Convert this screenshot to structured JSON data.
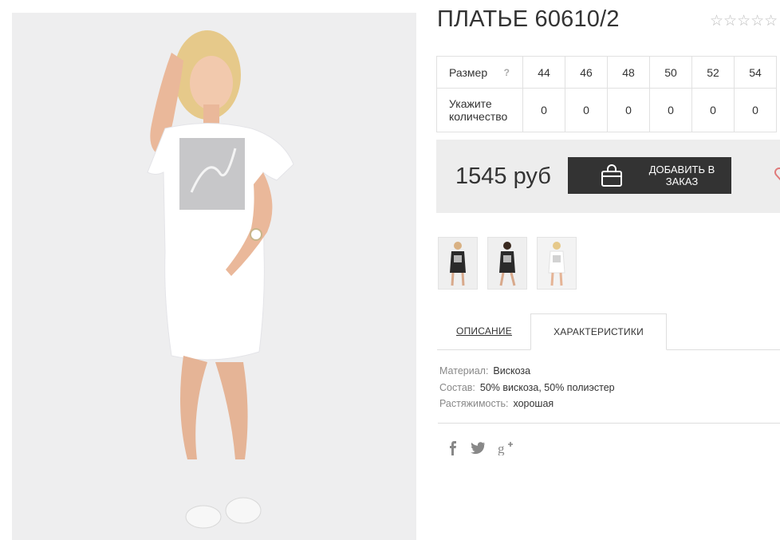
{
  "product": {
    "title": "ПЛАТЬЕ 60610/2",
    "rating_stars": "☆☆☆☆☆",
    "price": "1545 руб",
    "add_button": "ДОБАВИТЬ В ЗАКАЗ"
  },
  "size_table": {
    "size_label": "Размер",
    "help": "?",
    "qty_label_line1": "Укажите",
    "qty_label_line2": "количество",
    "sizes": [
      "44",
      "46",
      "48",
      "50",
      "52",
      "54"
    ],
    "quantities": [
      "0",
      "0",
      "0",
      "0",
      "0",
      "0"
    ]
  },
  "tabs": {
    "description": "ОПИСАНИЕ",
    "characteristics": "ХАРАКТЕРИСТИКИ"
  },
  "specs": [
    {
      "key": "Материал:",
      "value": "Вискоза"
    },
    {
      "key": "Состав:",
      "value": "50% вискоза, 50% полиэстер"
    },
    {
      "key": "Растяжимость:",
      "value": "хорошая"
    }
  ],
  "icons": {
    "bag": "shopping-bag-icon",
    "heart": "heart-icon",
    "facebook": "facebook-icon",
    "twitter": "twitter-icon",
    "gplus": "google-plus-icon"
  },
  "colors": {
    "button_bg": "#333333",
    "price_box_bg": "#ededed",
    "heart": "#e07a7a"
  }
}
